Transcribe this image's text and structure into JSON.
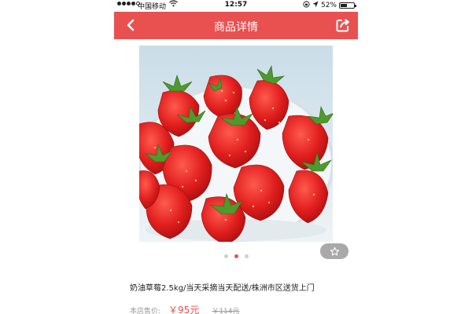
{
  "status_bar": {
    "carrier": "中国移动",
    "time": "12:57",
    "battery_text": "52%",
    "battery_level": 0.52,
    "signal_bars_filled": 4
  },
  "header": {
    "title": "商品详情",
    "back_icon": "chevron-left-icon",
    "share_icon": "share-icon",
    "color": "#e85150"
  },
  "gallery": {
    "image": "strawberries-in-glass-bowl",
    "slide_count": 3,
    "active_slide": 2,
    "favorite_icon": "star-outline-icon"
  },
  "product": {
    "title": "奶油草莓2.5kg/当天采摘当天配送/株洲市区送货上门",
    "price_label": "本店售价:",
    "price": "￥95元",
    "original_price": "￥114元"
  }
}
